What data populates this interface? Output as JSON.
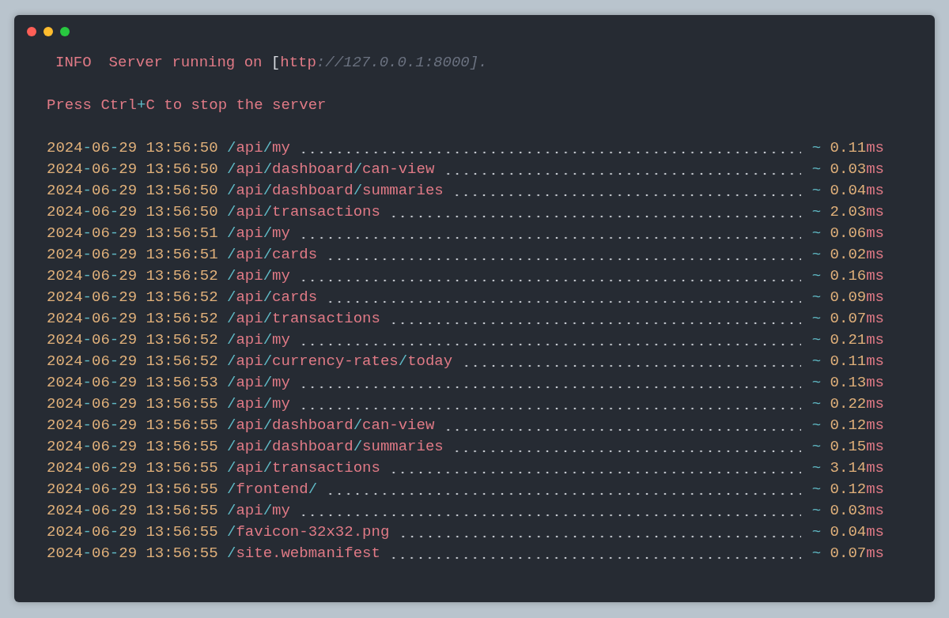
{
  "window": {
    "controls": [
      {
        "color": "#fe5f57"
      },
      {
        "color": "#febc2e"
      },
      {
        "color": "#28c840"
      }
    ]
  },
  "info": {
    "badge": "INFO",
    "message": [
      {
        "text": "Server running on ",
        "kind": "plain"
      },
      {
        "text": "[",
        "kind": "bracket"
      },
      {
        "text": "http",
        "kind": "plain"
      },
      {
        "text": ":",
        "kind": "muted"
      },
      {
        "text": "//127.0.0.1:8000].",
        "kind": "muted"
      }
    ]
  },
  "hint": [
    {
      "text": "Press Ctrl",
      "kind": "plain"
    },
    {
      "text": "+",
      "kind": "accent"
    },
    {
      "text": "C to stop the server",
      "kind": "plain"
    }
  ],
  "log": [
    {
      "date": "2024-06-29",
      "time": "13:56:50",
      "path": "/api/my",
      "tilde": "~",
      "duration": "0.11",
      "unit": "ms"
    },
    {
      "date": "2024-06-29",
      "time": "13:56:50",
      "path": "/api/dashboard/can-view",
      "tilde": "~",
      "duration": "0.03",
      "unit": "ms"
    },
    {
      "date": "2024-06-29",
      "time": "13:56:50",
      "path": "/api/dashboard/summaries",
      "tilde": "~",
      "duration": "0.04",
      "unit": "ms"
    },
    {
      "date": "2024-06-29",
      "time": "13:56:50",
      "path": "/api/transactions",
      "tilde": "~",
      "duration": "2.03",
      "unit": "ms"
    },
    {
      "date": "2024-06-29",
      "time": "13:56:51",
      "path": "/api/my",
      "tilde": "~",
      "duration": "0.06",
      "unit": "ms"
    },
    {
      "date": "2024-06-29",
      "time": "13:56:51",
      "path": "/api/cards",
      "tilde": "~",
      "duration": "0.02",
      "unit": "ms"
    },
    {
      "date": "2024-06-29",
      "time": "13:56:52",
      "path": "/api/my",
      "tilde": "~",
      "duration": "0.16",
      "unit": "ms"
    },
    {
      "date": "2024-06-29",
      "time": "13:56:52",
      "path": "/api/cards",
      "tilde": "~",
      "duration": "0.09",
      "unit": "ms"
    },
    {
      "date": "2024-06-29",
      "time": "13:56:52",
      "path": "/api/transactions",
      "tilde": "~",
      "duration": "0.07",
      "unit": "ms"
    },
    {
      "date": "2024-06-29",
      "time": "13:56:52",
      "path": "/api/my",
      "tilde": "~",
      "duration": "0.21",
      "unit": "ms"
    },
    {
      "date": "2024-06-29",
      "time": "13:56:52",
      "path": "/api/currency-rates/today",
      "tilde": "~",
      "duration": "0.11",
      "unit": "ms"
    },
    {
      "date": "2024-06-29",
      "time": "13:56:53",
      "path": "/api/my",
      "tilde": "~",
      "duration": "0.13",
      "unit": "ms"
    },
    {
      "date": "2024-06-29",
      "time": "13:56:55",
      "path": "/api/my",
      "tilde": "~",
      "duration": "0.22",
      "unit": "ms"
    },
    {
      "date": "2024-06-29",
      "time": "13:56:55",
      "path": "/api/dashboard/can-view",
      "tilde": "~",
      "duration": "0.12",
      "unit": "ms"
    },
    {
      "date": "2024-06-29",
      "time": "13:56:55",
      "path": "/api/dashboard/summaries",
      "tilde": "~",
      "duration": "0.15",
      "unit": "ms"
    },
    {
      "date": "2024-06-29",
      "time": "13:56:55",
      "path": "/api/transactions",
      "tilde": "~",
      "duration": "3.14",
      "unit": "ms"
    },
    {
      "date": "2024-06-29",
      "time": "13:56:55",
      "path": "/frontend/",
      "tilde": "~",
      "duration": "0.12",
      "unit": "ms"
    },
    {
      "date": "2024-06-29",
      "time": "13:56:55",
      "path": "/api/my",
      "tilde": "~",
      "duration": "0.03",
      "unit": "ms"
    },
    {
      "date": "2024-06-29",
      "time": "13:56:55",
      "path": "/favicon-32x32.png",
      "tilde": "~",
      "duration": "0.04",
      "unit": "ms"
    },
    {
      "date": "2024-06-29",
      "time": "13:56:55",
      "path": "/site.webmanifest",
      "tilde": "~",
      "duration": "0.07",
      "unit": "ms"
    }
  ]
}
